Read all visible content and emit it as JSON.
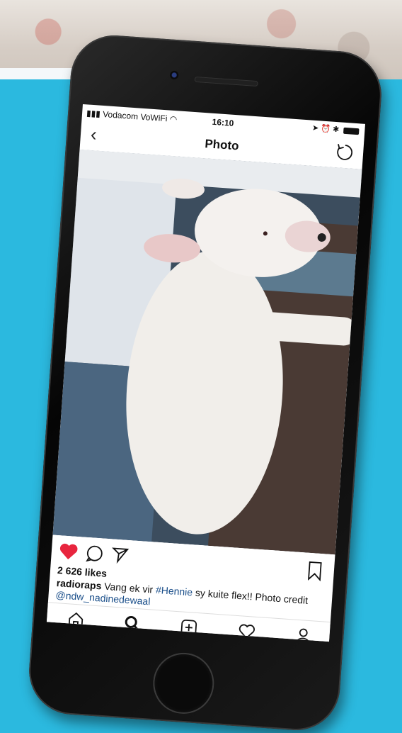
{
  "status_bar": {
    "carrier": "Vodacom VoWiFi",
    "time": "16:10"
  },
  "nav": {
    "title": "Photo"
  },
  "post": {
    "likes": "2 626 likes",
    "username": "radioraps",
    "caption_before": "Vang ek vir",
    "hashtag": "#Hennie",
    "caption_after": "sy kuite flex!! Photo credit",
    "mention": "@ndw_nadinedewaal",
    "liked": true
  },
  "colors": {
    "background": "#2bb9df",
    "like_red": "#e8253e",
    "link_blue": "#1b4f8a"
  },
  "icons": {
    "back": "chevron-left-icon",
    "rotate": "rotate-icon",
    "like": "heart-filled-icon",
    "comment": "comment-icon",
    "share": "send-icon",
    "save": "bookmark-icon",
    "home": "home-icon",
    "search": "search-icon",
    "add": "add-post-icon",
    "activity": "heart-outline-icon",
    "profile": "profile-icon"
  }
}
